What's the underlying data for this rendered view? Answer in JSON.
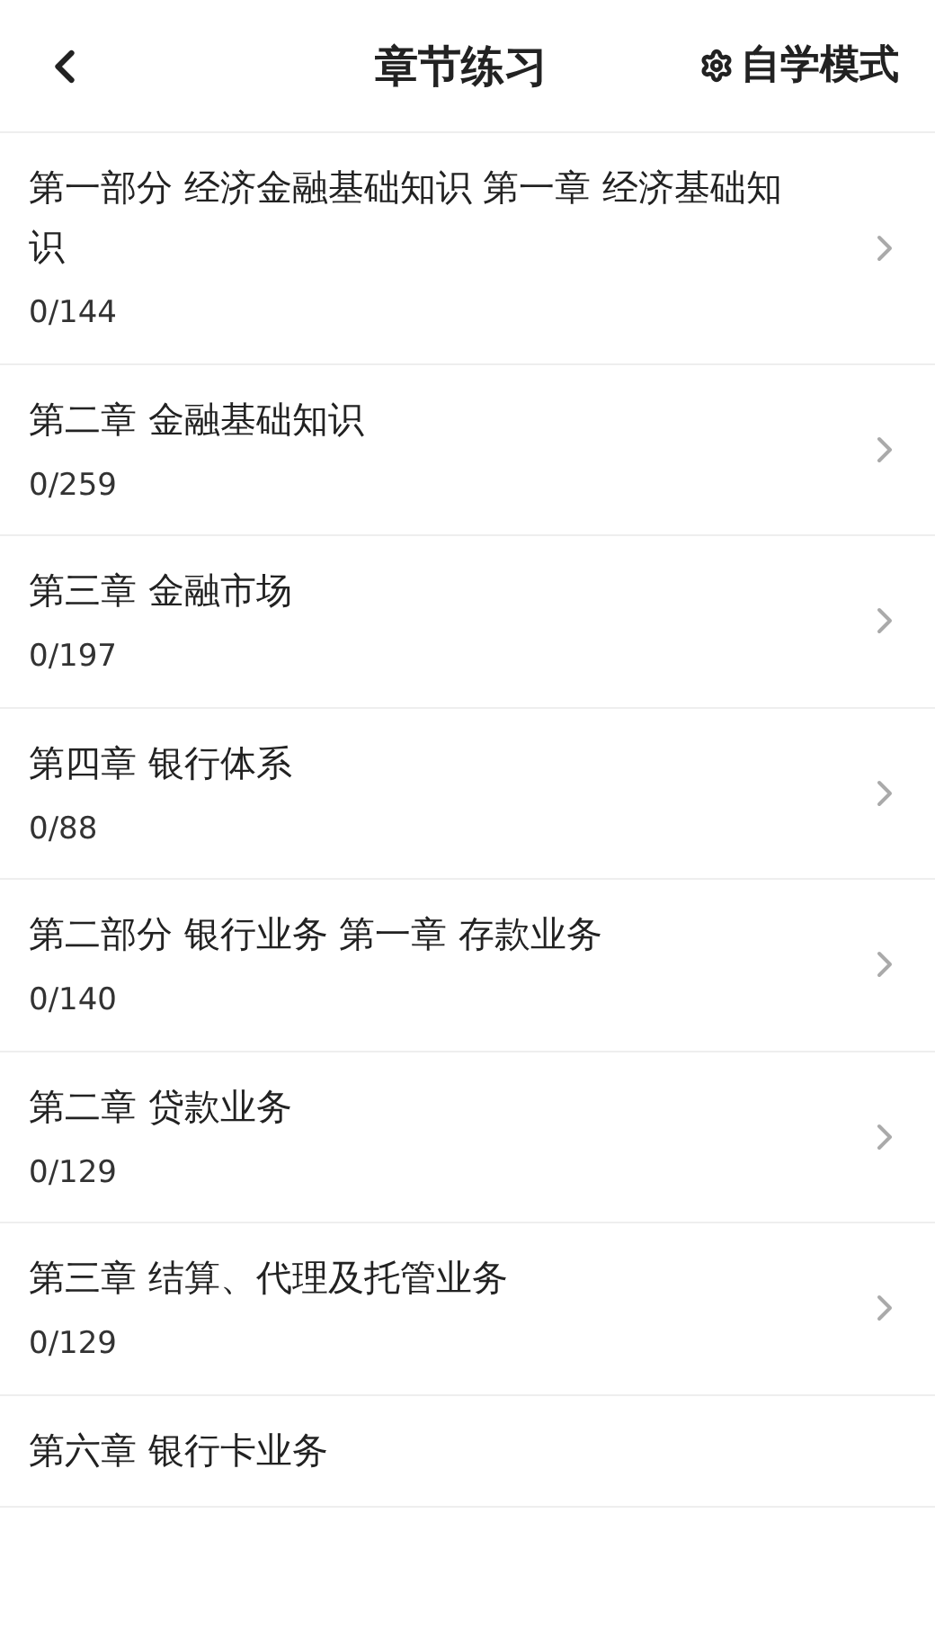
{
  "header": {
    "title": "章节练习",
    "mode_button": "自学模式"
  },
  "chapters": [
    {
      "title": "第一部分 经济金融基础知识 第一章 经济基础知识",
      "progress": "0/144"
    },
    {
      "title": "第二章 金融基础知识",
      "progress": "0/259"
    },
    {
      "title": "第三章 金融市场",
      "progress": "0/197"
    },
    {
      "title": "第四章 银行体系",
      "progress": "0/88"
    },
    {
      "title": "第二部分 银行业务  第一章 存款业务",
      "progress": "0/140"
    },
    {
      "title": "第二章 贷款业务",
      "progress": "0/129"
    },
    {
      "title": "第三章 结算、代理及托管业务",
      "progress": "0/129"
    },
    {
      "title": "第六章 银行卡业务"
    }
  ]
}
